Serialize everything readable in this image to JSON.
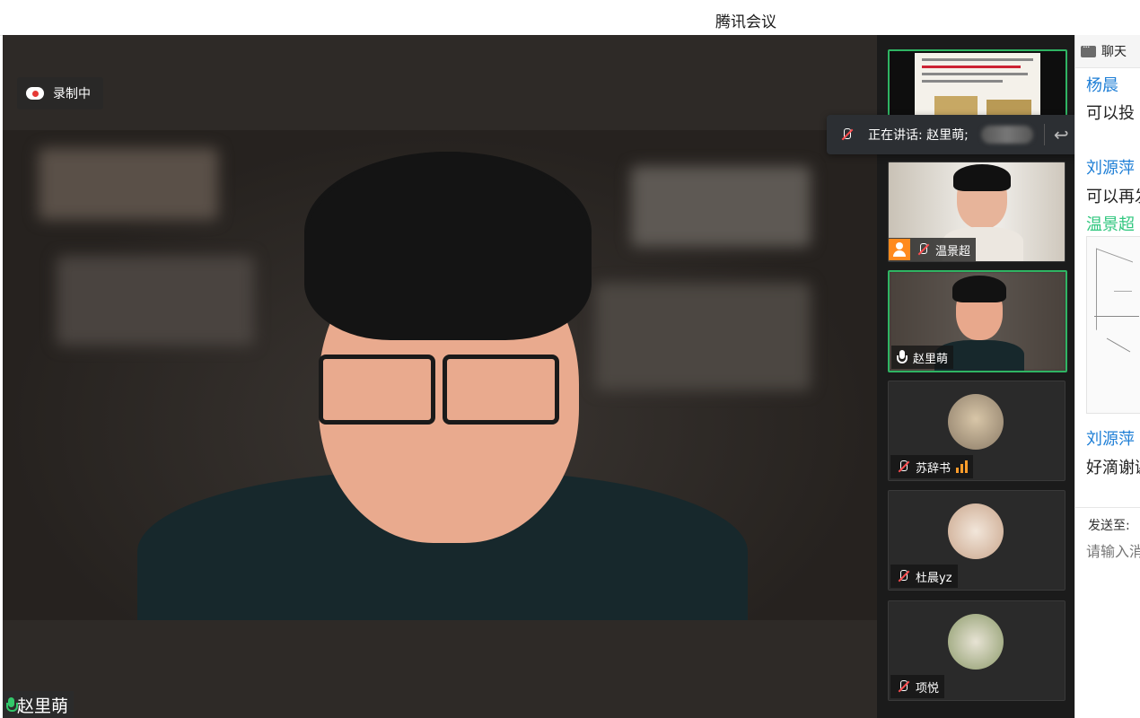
{
  "window": {
    "title": "腾讯会议"
  },
  "stage": {
    "recording_label": "录制中",
    "speaker_name": "赵里萌"
  },
  "speaking_popup": {
    "label": "正在讲话: 赵里萌;"
  },
  "participants": [
    {
      "name": "",
      "type": "shared-screen",
      "muted": false
    },
    {
      "name": "温景超",
      "role": "host",
      "muted": true
    },
    {
      "name": "赵里萌",
      "muted": false,
      "active": true
    },
    {
      "name": "苏辞书",
      "muted": true,
      "signal": true
    },
    {
      "name": "杜晨yz",
      "muted": true
    },
    {
      "name": "项悦",
      "muted": true
    }
  ],
  "chat": {
    "header": "聊天",
    "messages": [
      {
        "sender": "杨晨",
        "text": "可以投"
      },
      {
        "sender": "刘源萍",
        "text": "可以再发"
      },
      {
        "sender": "温景超",
        "text": ""
      },
      {
        "sender": "刘源萍",
        "text": "好滴谢谢"
      }
    ],
    "send_to_label": "发送至:",
    "input_placeholder": "请输入消息"
  },
  "colors": {
    "accent_green": "#2fb463",
    "link_blue": "#1f7fd6",
    "host_orange": "#ff8a1e",
    "muted_red": "#ff4d4f"
  }
}
